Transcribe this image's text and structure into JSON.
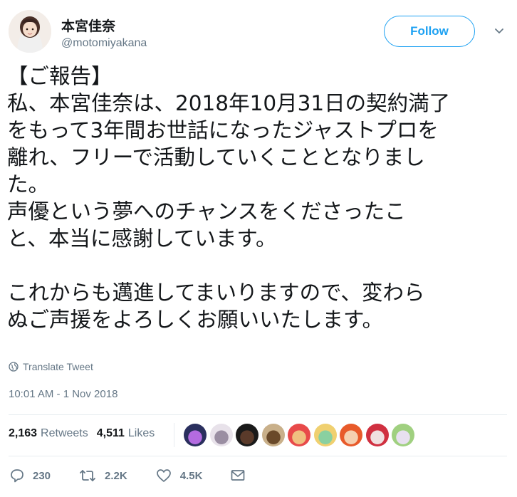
{
  "user": {
    "display_name": "本宮佳奈",
    "screen_name": "@motomiyakana"
  },
  "follow_button": {
    "label": "Follow"
  },
  "tweet": {
    "text": "【ご報告】\n私、本宮佳奈は、2018年10月31日の契約満了\nをもって3年間お世話になったジャストプロを\n離れ、フリーで活動していくこととなりまし\nた。\n声優という夢へのチャンスをくださったこ\nと、本当に感謝しています。\n\nこれからも邁進してまいりますので、変わら\nぬご声援をよろしくお願いいたします。"
  },
  "translate": {
    "label": "Translate Tweet",
    "icon": "globe-icon"
  },
  "timestamp": "10:01 AM - 1 Nov 2018",
  "stats": {
    "retweets_count": "2,163",
    "retweets_label": "Retweets",
    "likes_count": "4,511",
    "likes_label": "Likes"
  },
  "liked_by_avatars": [
    {
      "colors": [
        "#2a2f5e",
        "#b46be0"
      ]
    },
    {
      "colors": [
        "#e8e2ea",
        "#9a8ea2"
      ]
    },
    {
      "colors": [
        "#1a1a1a",
        "#5a3a2a"
      ]
    },
    {
      "colors": [
        "#c9b08a",
        "#6a4a2a"
      ]
    },
    {
      "colors": [
        "#e84a4a",
        "#f0c080"
      ]
    },
    {
      "colors": [
        "#f0d070",
        "#8ad0a0"
      ]
    },
    {
      "colors": [
        "#e85a2a",
        "#f5d0b0"
      ]
    },
    {
      "colors": [
        "#d03040",
        "#f0e0e0"
      ]
    },
    {
      "colors": [
        "#a0d080",
        "#e8e0f0"
      ]
    }
  ],
  "actions": {
    "reply_count": "230",
    "retweet_count": "2.2K",
    "like_count": "4.5K"
  },
  "colors": {
    "accent": "#1da1f2",
    "text": "#14171a",
    "muted": "#657786"
  }
}
